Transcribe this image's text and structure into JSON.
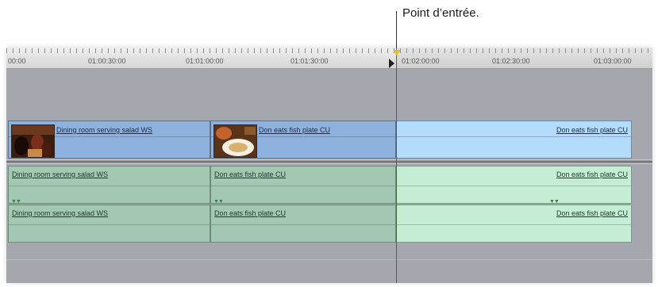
{
  "annotation": {
    "label": "Point d’entrée."
  },
  "ruler": {
    "timecodes": [
      "00:00",
      "01:00:30:00",
      "01:01:00:00",
      "01:01:30:00",
      "01:02:00:00",
      "01:02:30:00",
      "01:03:00:00"
    ]
  },
  "video_track": {
    "clips": [
      {
        "name": "Dining room serving salad WS",
        "has_thumbnail": true,
        "selected": false
      },
      {
        "name": "Don eats fish plate CU",
        "has_thumbnail": true,
        "selected": false
      },
      {
        "name": "Don eats fish plate CU",
        "has_thumbnail": false,
        "selected": true
      }
    ]
  },
  "audio_track_1": {
    "clips": [
      {
        "name": "Dining room serving salad WS",
        "selected": false
      },
      {
        "name": "Don eats fish plate CU",
        "selected": false
      },
      {
        "name": "Don eats fish plate CU",
        "selected": true
      }
    ]
  },
  "audio_track_2": {
    "clips": [
      {
        "name": "Dining room serving salad WS",
        "selected": false
      },
      {
        "name": "Don eats fish plate CU",
        "selected": false
      },
      {
        "name": "Don eats fish plate CU",
        "selected": true
      }
    ]
  },
  "colors": {
    "video_clip": "#8fb1de",
    "video_clip_selected": "#b3dcfb",
    "audio_clip": "#a2c7b2",
    "audio_clip_selected": "#c4edd3",
    "track_bg": "#a4a7ae",
    "in_point_marker": "#e3c21a"
  }
}
